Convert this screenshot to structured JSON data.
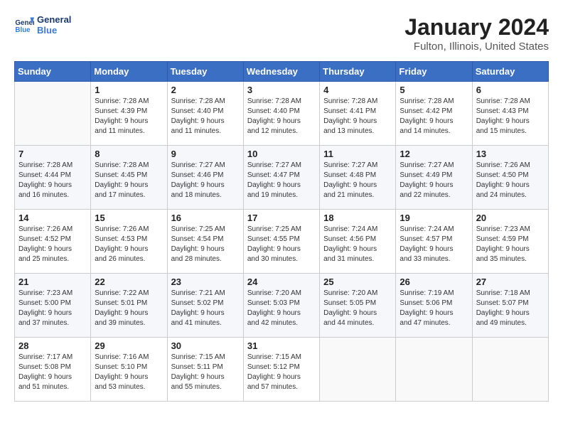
{
  "header": {
    "logo_line1": "General",
    "logo_line2": "Blue",
    "month": "January 2024",
    "location": "Fulton, Illinois, United States"
  },
  "weekdays": [
    "Sunday",
    "Monday",
    "Tuesday",
    "Wednesday",
    "Thursday",
    "Friday",
    "Saturday"
  ],
  "weeks": [
    [
      {
        "day": "",
        "info": ""
      },
      {
        "day": "1",
        "info": "Sunrise: 7:28 AM\nSunset: 4:39 PM\nDaylight: 9 hours\nand 11 minutes."
      },
      {
        "day": "2",
        "info": "Sunrise: 7:28 AM\nSunset: 4:40 PM\nDaylight: 9 hours\nand 11 minutes."
      },
      {
        "day": "3",
        "info": "Sunrise: 7:28 AM\nSunset: 4:40 PM\nDaylight: 9 hours\nand 12 minutes."
      },
      {
        "day": "4",
        "info": "Sunrise: 7:28 AM\nSunset: 4:41 PM\nDaylight: 9 hours\nand 13 minutes."
      },
      {
        "day": "5",
        "info": "Sunrise: 7:28 AM\nSunset: 4:42 PM\nDaylight: 9 hours\nand 14 minutes."
      },
      {
        "day": "6",
        "info": "Sunrise: 7:28 AM\nSunset: 4:43 PM\nDaylight: 9 hours\nand 15 minutes."
      }
    ],
    [
      {
        "day": "7",
        "info": "Sunrise: 7:28 AM\nSunset: 4:44 PM\nDaylight: 9 hours\nand 16 minutes."
      },
      {
        "day": "8",
        "info": "Sunrise: 7:28 AM\nSunset: 4:45 PM\nDaylight: 9 hours\nand 17 minutes."
      },
      {
        "day": "9",
        "info": "Sunrise: 7:27 AM\nSunset: 4:46 PM\nDaylight: 9 hours\nand 18 minutes."
      },
      {
        "day": "10",
        "info": "Sunrise: 7:27 AM\nSunset: 4:47 PM\nDaylight: 9 hours\nand 19 minutes."
      },
      {
        "day": "11",
        "info": "Sunrise: 7:27 AM\nSunset: 4:48 PM\nDaylight: 9 hours\nand 21 minutes."
      },
      {
        "day": "12",
        "info": "Sunrise: 7:27 AM\nSunset: 4:49 PM\nDaylight: 9 hours\nand 22 minutes."
      },
      {
        "day": "13",
        "info": "Sunrise: 7:26 AM\nSunset: 4:50 PM\nDaylight: 9 hours\nand 24 minutes."
      }
    ],
    [
      {
        "day": "14",
        "info": "Sunrise: 7:26 AM\nSunset: 4:52 PM\nDaylight: 9 hours\nand 25 minutes."
      },
      {
        "day": "15",
        "info": "Sunrise: 7:26 AM\nSunset: 4:53 PM\nDaylight: 9 hours\nand 26 minutes."
      },
      {
        "day": "16",
        "info": "Sunrise: 7:25 AM\nSunset: 4:54 PM\nDaylight: 9 hours\nand 28 minutes."
      },
      {
        "day": "17",
        "info": "Sunrise: 7:25 AM\nSunset: 4:55 PM\nDaylight: 9 hours\nand 30 minutes."
      },
      {
        "day": "18",
        "info": "Sunrise: 7:24 AM\nSunset: 4:56 PM\nDaylight: 9 hours\nand 31 minutes."
      },
      {
        "day": "19",
        "info": "Sunrise: 7:24 AM\nSunset: 4:57 PM\nDaylight: 9 hours\nand 33 minutes."
      },
      {
        "day": "20",
        "info": "Sunrise: 7:23 AM\nSunset: 4:59 PM\nDaylight: 9 hours\nand 35 minutes."
      }
    ],
    [
      {
        "day": "21",
        "info": "Sunrise: 7:23 AM\nSunset: 5:00 PM\nDaylight: 9 hours\nand 37 minutes."
      },
      {
        "day": "22",
        "info": "Sunrise: 7:22 AM\nSunset: 5:01 PM\nDaylight: 9 hours\nand 39 minutes."
      },
      {
        "day": "23",
        "info": "Sunrise: 7:21 AM\nSunset: 5:02 PM\nDaylight: 9 hours\nand 41 minutes."
      },
      {
        "day": "24",
        "info": "Sunrise: 7:20 AM\nSunset: 5:03 PM\nDaylight: 9 hours\nand 42 minutes."
      },
      {
        "day": "25",
        "info": "Sunrise: 7:20 AM\nSunset: 5:05 PM\nDaylight: 9 hours\nand 44 minutes."
      },
      {
        "day": "26",
        "info": "Sunrise: 7:19 AM\nSunset: 5:06 PM\nDaylight: 9 hours\nand 47 minutes."
      },
      {
        "day": "27",
        "info": "Sunrise: 7:18 AM\nSunset: 5:07 PM\nDaylight: 9 hours\nand 49 minutes."
      }
    ],
    [
      {
        "day": "28",
        "info": "Sunrise: 7:17 AM\nSunset: 5:08 PM\nDaylight: 9 hours\nand 51 minutes."
      },
      {
        "day": "29",
        "info": "Sunrise: 7:16 AM\nSunset: 5:10 PM\nDaylight: 9 hours\nand 53 minutes."
      },
      {
        "day": "30",
        "info": "Sunrise: 7:15 AM\nSunset: 5:11 PM\nDaylight: 9 hours\nand 55 minutes."
      },
      {
        "day": "31",
        "info": "Sunrise: 7:15 AM\nSunset: 5:12 PM\nDaylight: 9 hours\nand 57 minutes."
      },
      {
        "day": "",
        "info": ""
      },
      {
        "day": "",
        "info": ""
      },
      {
        "day": "",
        "info": ""
      }
    ]
  ]
}
